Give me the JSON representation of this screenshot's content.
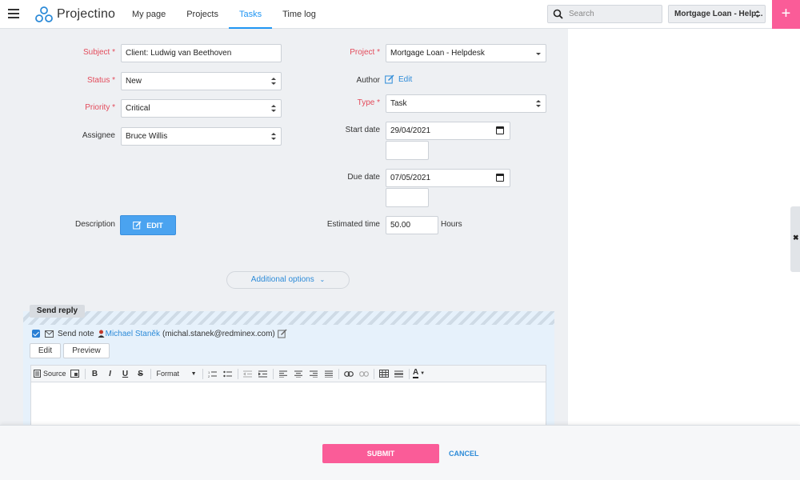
{
  "app": {
    "name": "Projectino"
  },
  "nav": {
    "items": [
      {
        "label": "My page"
      },
      {
        "label": "Projects"
      },
      {
        "label": "Tasks"
      },
      {
        "label": "Time log"
      }
    ],
    "active": "Tasks"
  },
  "search": {
    "placeholder": "Search"
  },
  "project_switcher": {
    "value": "Mortgage Loan - Help..."
  },
  "form": {
    "subject": {
      "label": "Subject *",
      "value": "Client: Ludwig van Beethoven"
    },
    "status": {
      "label": "Status *",
      "value": "New"
    },
    "priority": {
      "label": "Priority *",
      "value": "Critical"
    },
    "assignee": {
      "label": "Assignee",
      "value": "Bruce Willis"
    },
    "description": {
      "label": "Description",
      "button": "EDIT"
    },
    "project": {
      "label": "Project *",
      "value": "Mortgage Loan - Helpdesk"
    },
    "author": {
      "label": "Author",
      "link": "Edit"
    },
    "type": {
      "label": "Type *",
      "value": "Task"
    },
    "start_date": {
      "label": "Start date",
      "value": "29/04/2021"
    },
    "due_date": {
      "label": "Due date",
      "value": "07/05/2021"
    },
    "estimated_time": {
      "label": "Estimated time",
      "value": "50.00",
      "unit": "Hours"
    }
  },
  "additional_options": {
    "label": "Additional options"
  },
  "reply": {
    "tag": "Send reply",
    "send_note": "Send note",
    "user_name": "Michael Staněk",
    "user_email": "(michal.stanek@redminex.com)",
    "tabs": [
      "Edit",
      "Preview"
    ],
    "toolbar": {
      "source": "Source",
      "format": "Format"
    }
  },
  "footer": {
    "submit": "SUBMIT",
    "cancel": "CANCEL"
  },
  "colors": {
    "accent": "#2196f3",
    "brand_pink": "#fa5c98",
    "required": "#e34b5b",
    "link": "#2d8bd8"
  }
}
